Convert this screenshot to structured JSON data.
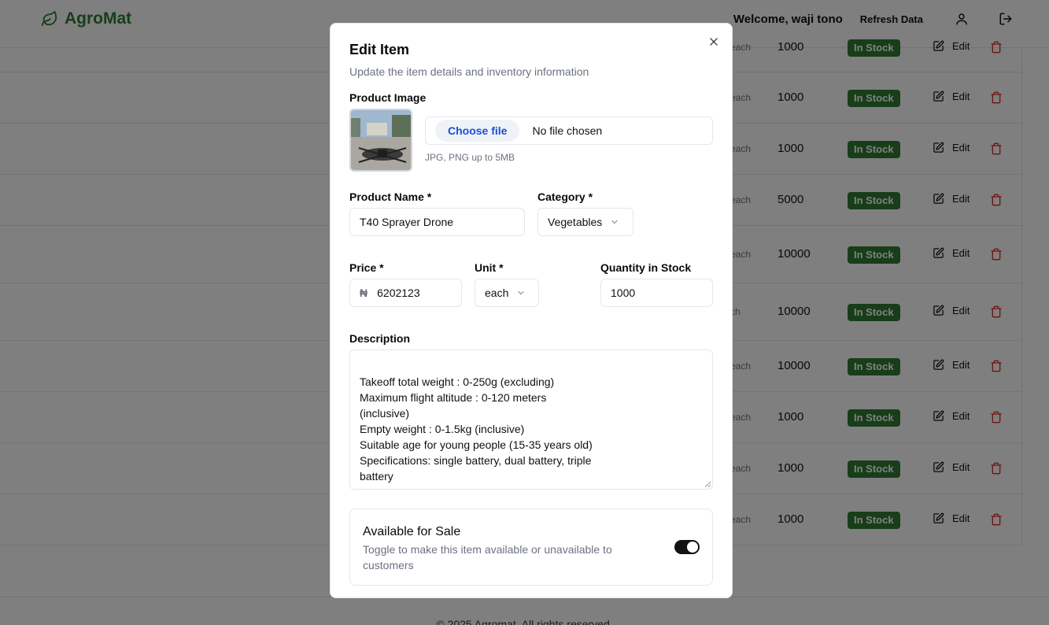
{
  "app": {
    "brand": "AgroMat",
    "welcome": "Welcome, waji tono",
    "refresh_label": "Refresh Data",
    "brand_color": "#2e7d32"
  },
  "table": {
    "rows": [
      {
        "unit": "each",
        "qty": "1000",
        "status": "In Stock",
        "edit": "Edit"
      },
      {
        "unit": "each",
        "qty": "1000",
        "status": "In Stock",
        "edit": "Edit"
      },
      {
        "unit": "each",
        "qty": "1000",
        "status": "In Stock",
        "edit": "Edit"
      },
      {
        "unit": "each",
        "qty": "5000",
        "status": "In Stock",
        "edit": "Edit"
      },
      {
        "unit": "each",
        "qty": "10000",
        "status": "In Stock",
        "edit": "Edit"
      },
      {
        "unit": "ch",
        "qty": "10000",
        "status": "In Stock",
        "edit": "Edit"
      },
      {
        "unit": "each",
        "qty": "10000",
        "status": "In Stock",
        "edit": "Edit"
      },
      {
        "unit": "each",
        "qty": "1000",
        "status": "In Stock",
        "edit": "Edit"
      },
      {
        "unit": "each",
        "qty": "1000",
        "status": "In Stock",
        "edit": "Edit"
      },
      {
        "unit": "each",
        "qty": "1000",
        "status": "In Stock",
        "edit": "Edit"
      }
    ]
  },
  "footer": {
    "text": "© 2025 Agromat. All rights reserved."
  },
  "modal": {
    "title": "Edit Item",
    "subtitle": "Update the item details and inventory information",
    "image_label": "Product Image",
    "choose_file": "Choose file",
    "no_file": "No file chosen",
    "file_hint": "JPG, PNG up to 5MB",
    "name_label": "Product Name *",
    "name_value": "T40 Sprayer Drone",
    "category_label": "Category *",
    "category_value": "Vegetables",
    "price_label": "Price *",
    "currency": "₦",
    "price_value": "6202123",
    "unit_label": "Unit *",
    "unit_value": "each",
    "qty_label": "Quantity in Stock",
    "qty_value": "1000",
    "desc_label": "Description",
    "desc_value": "Takeoff total weight : 0-250g (excluding)\nMaximum flight altitude : 0-120 meters (inclusive)\nEmpty weight : 0-1.5kg (inclusive)\nSuitable age for young people (15-35 years old)\nSpecifications: single battery, dual battery, triple battery",
    "avail_title": "Available for Sale",
    "avail_desc": "Toggle to make this item available or unavailable to customers",
    "available": true
  }
}
